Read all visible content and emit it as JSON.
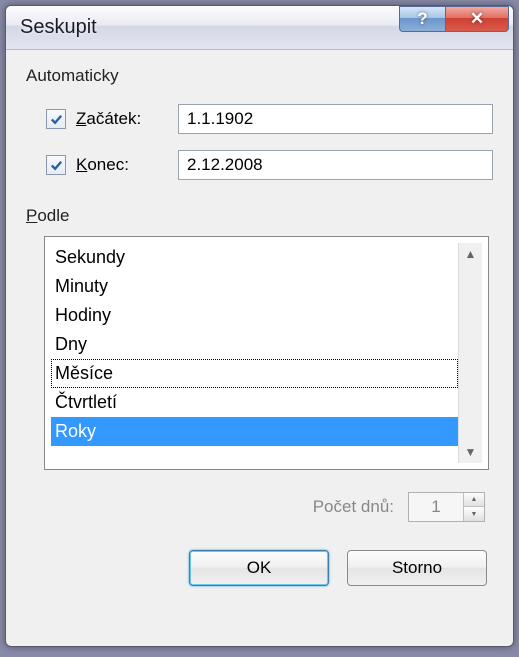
{
  "title": "Seskupit",
  "sections": {
    "auto_label": "Automaticky",
    "start": {
      "label_pre": "Z",
      "label_rest": "ačátek:",
      "value": "1.1.1902",
      "checked": true
    },
    "end": {
      "label_pre": "K",
      "label_rest": "onec:",
      "value": "2.12.2008",
      "checked": true
    },
    "by_label_pre": "P",
    "by_label_rest": "odle",
    "count_label": "Počet dnů:",
    "count_value": "1"
  },
  "list": {
    "items": [
      "Sekundy",
      "Minuty",
      "Hodiny",
      "Dny",
      "Měsíce",
      "Čtvrtletí",
      "Roky"
    ],
    "selected_index": 6,
    "focused_index": 4
  },
  "buttons": {
    "ok": "OK",
    "cancel": "Storno"
  }
}
